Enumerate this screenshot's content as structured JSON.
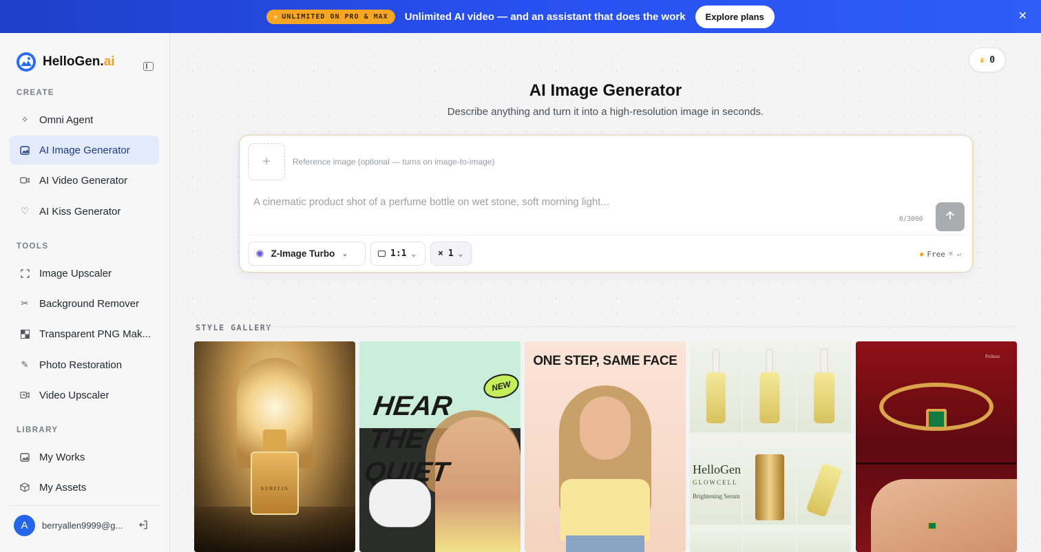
{
  "banner": {
    "pill": "UNLIMITED ON PRO & MAX",
    "text": "Unlimited AI video — and an assistant that does the work",
    "cta": "Explore plans",
    "close": "✕"
  },
  "brand": {
    "name": "HelloGen.",
    "suffix": "ai"
  },
  "sidebar": {
    "sections": {
      "create": "CREATE",
      "tools": "TOOLS",
      "library": "LIBRARY"
    },
    "create_items": [
      {
        "label": "Omni Agent",
        "icon": "sparkle-icon"
      },
      {
        "label": "AI Image Generator",
        "icon": "image-icon",
        "active": true
      },
      {
        "label": "AI Video Generator",
        "icon": "video-icon"
      },
      {
        "label": "AI Kiss Generator",
        "icon": "heart-icon"
      }
    ],
    "tool_items": [
      {
        "label": "Image Upscaler",
        "icon": "expand-icon"
      },
      {
        "label": "Background Remover",
        "icon": "scissors-icon"
      },
      {
        "label": "Transparent PNG Mak...",
        "icon": "checker-icon"
      },
      {
        "label": "Photo Restoration",
        "icon": "pencil-icon"
      },
      {
        "label": "Video Upscaler",
        "icon": "video-upscale-icon"
      }
    ],
    "library_items": [
      {
        "label": "My Works",
        "icon": "image-icon"
      },
      {
        "label": "My Assets",
        "icon": "box-icon"
      }
    ],
    "user": {
      "avatar": "A",
      "email": "berryallen9999@g..."
    }
  },
  "credits": {
    "value": "0",
    "icon": "crown-icon"
  },
  "header": {
    "title": "AI Image Generator",
    "subtitle": "Describe anything and turn it into a high-resolution image in seconds."
  },
  "composer": {
    "reference_hint": "Reference image (optional — turns on image-to-image)",
    "reference_plus": "+",
    "prompt_placeholder": "A cinematic product shot of a perfume bottle on wet stone, soft morning light...",
    "char_count": "0/3000",
    "model": "Z-Image Turbo",
    "ratio": "1:1",
    "count": "1",
    "count_prefix": "×",
    "price": "Free",
    "shortcut": "⌘ ↵"
  },
  "gallery": {
    "label": "STYLE GALLERY",
    "cards": [
      {
        "id": "perfume",
        "text": "AURELIA"
      },
      {
        "id": "earbuds",
        "text": "HEAR THE QUIET",
        "badge": "NEW"
      },
      {
        "id": "portrait",
        "text": "ONE STEP, SAME FACE"
      },
      {
        "id": "serum",
        "text": "HelloGen",
        "sub": "GLOWCELL",
        "sub2": "Brightening Serum"
      },
      {
        "id": "ring",
        "text": "Polluxe"
      }
    ]
  },
  "colors": {
    "banner": "#2750f0",
    "accent": "#2b6cf0",
    "active_nav_bg": "#e3ebfb",
    "gold": "#f0a020"
  }
}
